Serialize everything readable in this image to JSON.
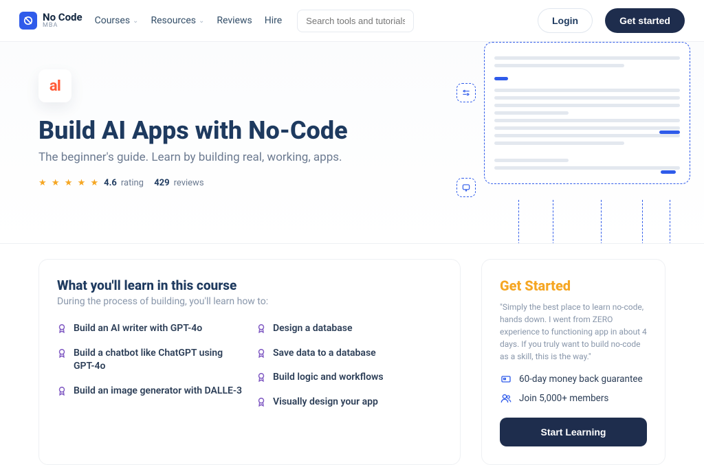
{
  "header": {
    "logo_main": "No Code",
    "logo_sub": "MBA",
    "nav": {
      "courses": "Courses",
      "resources": "Resources",
      "reviews": "Reviews",
      "hire": "Hire"
    },
    "search_placeholder": "Search tools and tutorials",
    "login": "Login",
    "get_started": "Get started"
  },
  "hero": {
    "badge": "aI",
    "title": "Build AI Apps with No-Code",
    "subtitle": "The beginner's guide. Learn by building real, working, apps.",
    "rating_value": "4.6",
    "rating_label": "rating",
    "review_count": "429",
    "review_label": "reviews"
  },
  "learn": {
    "heading": "What you'll learn in this course",
    "lead": "During the process of building, you'll learn how to:",
    "col1": [
      "Build an AI writer with GPT-4o",
      "Build a chatbot like ChatGPT using GPT-4o",
      "Build an image generator with DALLE-3"
    ],
    "col2": [
      "Design a database",
      "Save data to a database",
      "Build logic and workflows",
      "Visually design your app"
    ]
  },
  "sidebar": {
    "heading": "Get Started",
    "quote": "\"Simply the best place to learn no-code, hands down. I went from ZERO experience to functioning app in about 4 days. If you truly want to build no-code as a skill, this is the way.\"",
    "guarantee": "60-day money back guarantee",
    "members": "Join 5,000+ members",
    "cta": "Start Learning"
  }
}
